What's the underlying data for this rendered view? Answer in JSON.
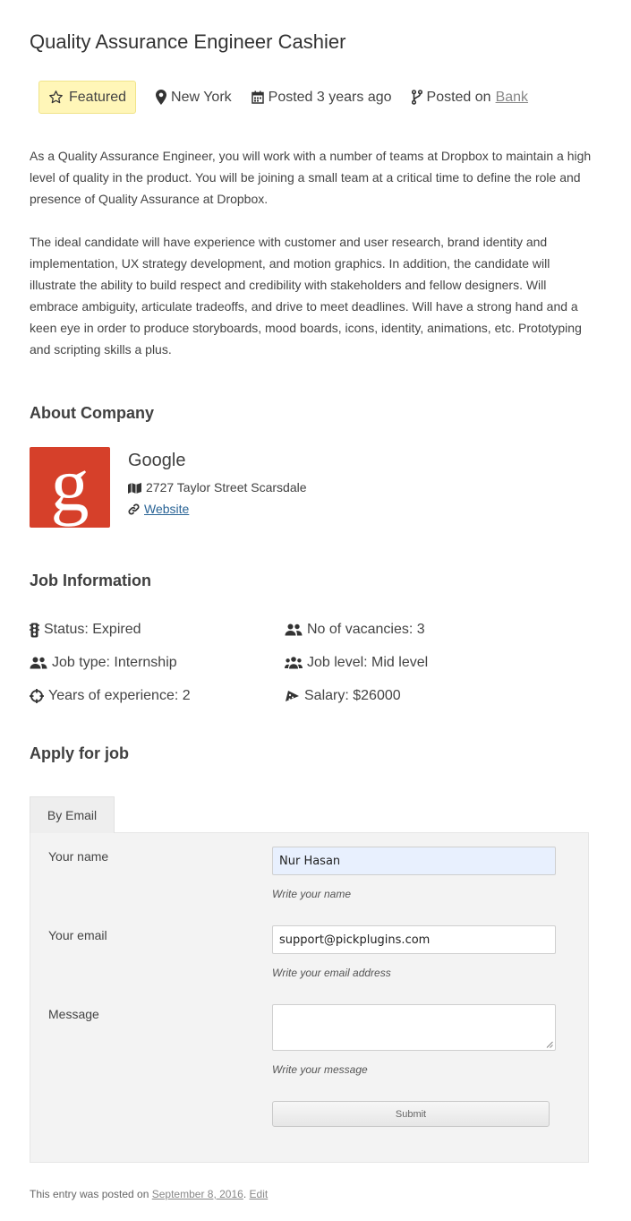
{
  "job": {
    "title": "Quality Assurance Engineer Cashier",
    "meta": {
      "featured": "Featured",
      "location": "New York",
      "posted": "Posted 3 years ago",
      "posted_on_prefix": "Posted on",
      "posted_on_link": "Bank"
    },
    "description": [
      "As a Quality Assurance Engineer, you will work with a number of teams at Dropbox to maintain a high level of quality in the product. You will be joining a small team at a critical time to define the role and presence of Quality Assurance at Dropbox.",
      "The ideal candidate will have experience with customer and user research, brand identity and implementation, UX strategy development, and motion graphics. In addition, the candidate will illustrate the ability to build respect and credibility with stakeholders and fellow designers. Will embrace ambiguity, articulate tradeoffs, and drive to meet deadlines. Will have a strong hand and a keen eye in order to produce storyboards, mood boards, icons, identity, animations, etc. Prototyping and scripting skills a plus."
    ]
  },
  "about_company": {
    "heading": "About Company",
    "logo_letter": "g",
    "name": "Google",
    "address": "2727 Taylor Street Scarsdale",
    "website": "Website",
    "colors": {
      "logo_bg": "#d6402a"
    }
  },
  "job_information": {
    "heading": "Job Information",
    "status": "Status: Expired",
    "vacancies": "No of vacancies: 3",
    "job_type": "Job type: Internship",
    "job_level": "Job level: Mid level",
    "experience": "Years of experience: 2",
    "salary": "Salary: $26000"
  },
  "apply": {
    "heading": "Apply for job",
    "tab": "By Email",
    "name_label": "Your name",
    "name_value": "Nur Hasan",
    "name_hint": "Write your name",
    "email_label": "Your email",
    "email_value": "support@pickplugins.com",
    "email_hint": "Write your email address",
    "message_label": "Message",
    "message_value": "",
    "message_hint": "Write your message",
    "submit": "Submit"
  },
  "footer": {
    "prefix": "This entry was posted on",
    "date": "September 8, 2016",
    "separator": ".",
    "edit": "Edit"
  },
  "icons": [
    "star-icon",
    "map-marker-icon",
    "calendar-icon",
    "code-fork-icon",
    "map-icon",
    "link-icon",
    "traffic-light-icon",
    "users-icon",
    "user-group-icon",
    "crosshairs-icon",
    "money-icon",
    "resize-grip-icon"
  ]
}
